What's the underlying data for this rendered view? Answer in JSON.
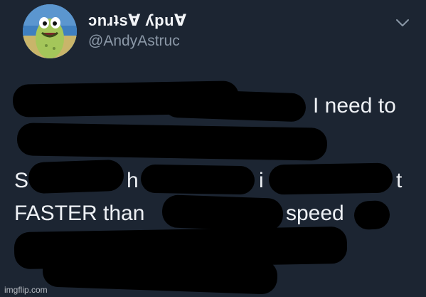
{
  "tweet": {
    "display_name": "ɔnɹʇsⱯ ʎpuⱯ",
    "handle": "@AndyAstruc",
    "menu_icon": "chevron-down-icon",
    "lines": {
      "l1": "I need to",
      "l3a": "S",
      "l3b": "h",
      "l3c": "i",
      "l3d": "t",
      "l4a": "FASTER than",
      "l4b": "speed"
    }
  },
  "watermark": "imgflip.com",
  "colors": {
    "background": "#1c2532",
    "text": "#eef1f5",
    "handle": "#8b98a7",
    "redaction": "#000000"
  }
}
